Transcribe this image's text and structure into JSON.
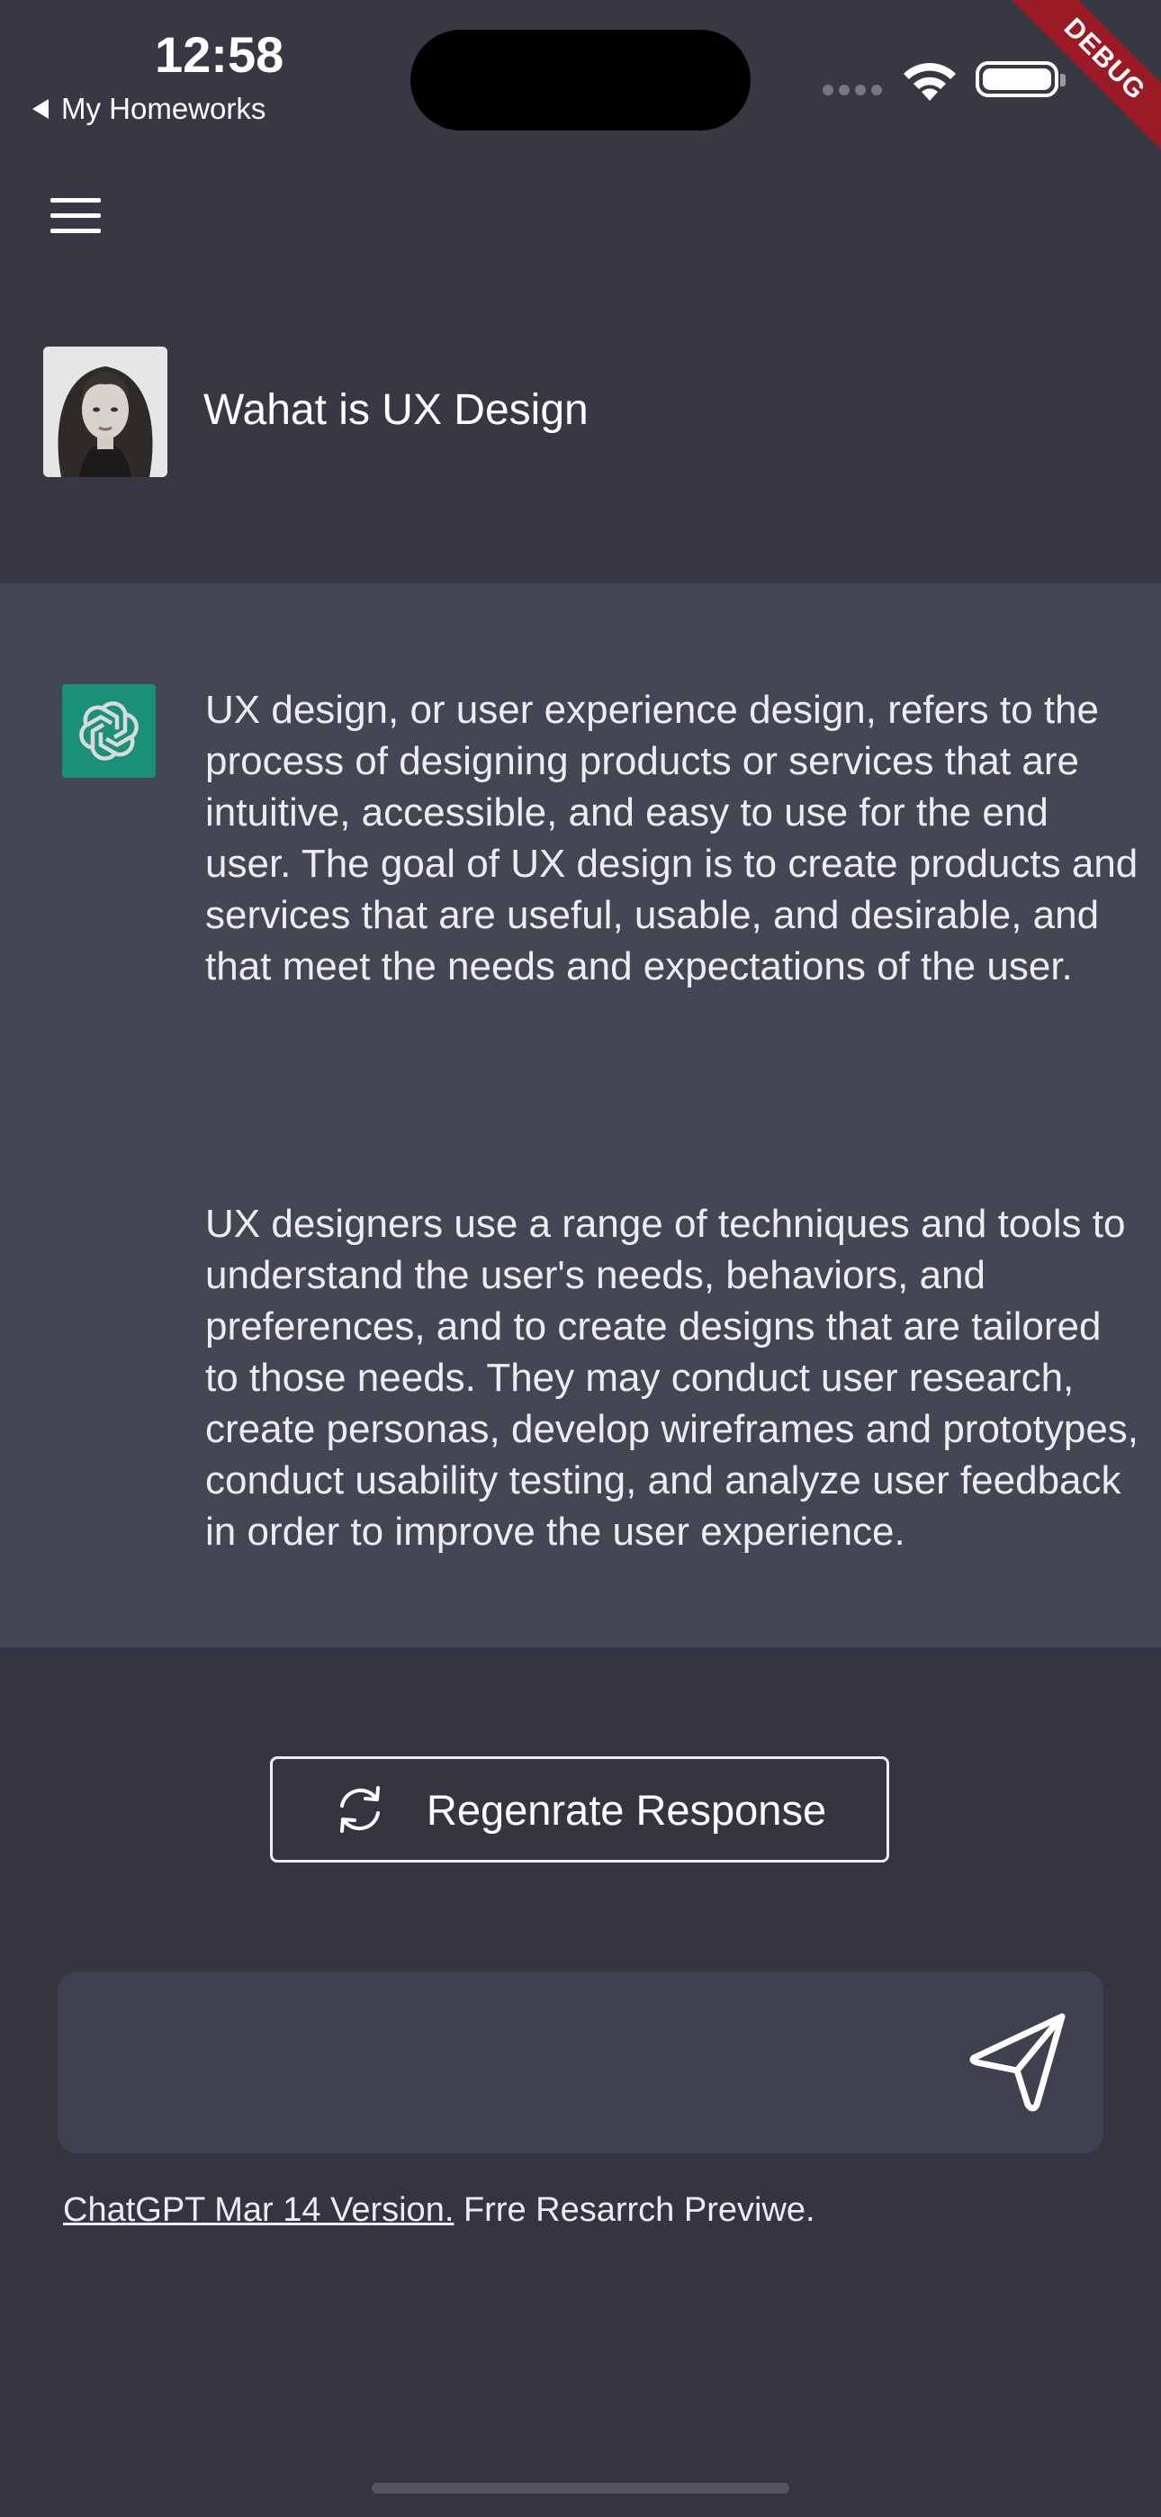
{
  "status_bar": {
    "time": "12:58",
    "back_app": "My Homeworks",
    "debug_label": "DEBUG"
  },
  "header": {
    "conversation_title": "Wahat is UX Design"
  },
  "messages": [
    "UX design, or user experience design, refers to the process of designing products or services that are intuitive, accessible, and easy to use for the end user. The goal of UX design is to create products and services that are useful, usable, and desirable, and that meet the needs and expectations of the user.",
    "UX designers use a range of techniques and tools to understand the user's needs, behaviors, and preferences, and to create designs that are tailored to those needs. They may conduct user research, create personas, develop wireframes and prototypes, conduct usability testing, and analyze user feedback in order to improve the user experience."
  ],
  "actions": {
    "regenerate_label": "Regenrate Response"
  },
  "composer": {
    "placeholder": ""
  },
  "footer": {
    "version_link": "ChatGPT Mar 14 Version.",
    "note": "Frre Resarrch Previwe."
  },
  "colors": {
    "background": "#343541",
    "chat_background": "#444654",
    "assistant_icon": "#10a37f",
    "debug_banner": "#9b1b25"
  },
  "icons": {
    "menu": "hamburger-menu-icon",
    "assistant": "openai-logo-icon",
    "regenerate": "refresh-icon",
    "send": "send-icon"
  }
}
